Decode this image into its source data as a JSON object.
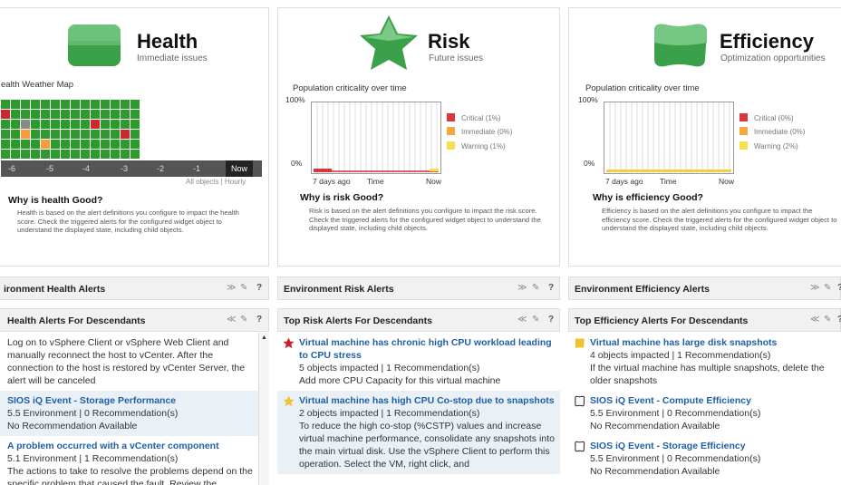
{
  "health": {
    "title": "Health",
    "subtitle": "Immediate issues",
    "map_title": "ealth Weather Map",
    "time_labels": [
      "-6",
      "-5",
      "-4",
      "-3",
      "-2",
      "-1"
    ],
    "now_label": "Now",
    "footer": "All objects | Hourly",
    "why_title": "Why is health Good?",
    "why_text": "Health is based on the alert definitions you configure to impact the health score. Check the triggered alerts for the configured widget object to understand the displayed state, including child objects.",
    "cells": [
      "g",
      "g",
      "g",
      "g",
      "g",
      "g",
      "g",
      "g",
      "g",
      "g",
      "g",
      "g",
      "g",
      "g",
      "r",
      "g",
      "g",
      "g",
      "g",
      "g",
      "g",
      "g",
      "g",
      "g",
      "g",
      "g",
      "g",
      "g",
      "g",
      "g",
      "gr",
      "g",
      "g",
      "g",
      "g",
      "g",
      "g",
      "r",
      "g",
      "g",
      "g",
      "g",
      "g",
      "g",
      "o",
      "g",
      "g",
      "g",
      "g",
      "g",
      "g",
      "g",
      "g",
      "g",
      "r",
      "g",
      "g",
      "g",
      "g",
      "g",
      "o",
      "g",
      "g",
      "g",
      "g",
      "g",
      "g",
      "g",
      "g",
      "g",
      "g",
      "g",
      "g",
      "g",
      "g",
      "g",
      "g",
      "g",
      "g",
      "g",
      "g",
      "g",
      "g",
      "g"
    ],
    "colors": {
      "g": "#2c9a2c",
      "r": "#d0262f",
      "o": "#f59b38",
      "gr": "#8a8a8a"
    }
  },
  "risk": {
    "title": "Risk",
    "subtitle": "Future issues",
    "chart_title": "Population criticality over time",
    "y_top": "100%",
    "y_bottom": "0%",
    "x_start": "7 days ago",
    "x_mid": "Time",
    "x_end": "Now",
    "legend": [
      {
        "label": "Critical (1%)",
        "color": "#d9363e"
      },
      {
        "label": "Immediate (0%)",
        "color": "#f5a742"
      },
      {
        "label": "Warning (1%)",
        "color": "#f4e04d"
      }
    ],
    "why_title": "Why is risk Good?",
    "why_text": "Risk is based on the alert definitions you configure to impact the risk score. Check the triggered alerts for the configured widget object to understand the displayed state, including child objects."
  },
  "efficiency": {
    "title": "Efficiency",
    "subtitle": "Optimization opportunities",
    "chart_title": "Population criticality over time",
    "y_top": "100%",
    "y_bottom": "0%",
    "x_start": "7 days ago",
    "x_mid": "Time",
    "x_end": "Now",
    "legend": [
      {
        "label": "Critical (0%)",
        "color": "#d9363e"
      },
      {
        "label": "Immediate (0%)",
        "color": "#f5a742"
      },
      {
        "label": "Warning (2%)",
        "color": "#f4e04d"
      }
    ],
    "why_title": "Why is efficiency Good?",
    "why_text": "Efficiency is based on the alert definitions you configure to impact the efficiency score. Check the triggered alerts for the configured widget object to understand the displayed state, including child objects."
  },
  "bars": {
    "env_health": "ironment Health Alerts",
    "env_risk": "Environment Risk Alerts",
    "env_eff": "Environment Efficiency Alerts",
    "top_health": "Health Alerts For Descendants",
    "top_risk": "Top Risk Alerts For Descendants",
    "top_eff": "Top Efficiency Alerts For Descendants",
    "icon_collapse": "≫",
    "icon_expand": "≪",
    "icon_edit": "✎",
    "icon_help": "?"
  },
  "health_alerts": [
    {
      "title": "",
      "lines": [
        "Log on to vSphere Client or vSphere Web Client and manually reconnect the host to vCenter. After the connection to the host is restored by vCenter Server, the alert will be canceled"
      ]
    },
    {
      "title": "SIOS iQ Event - Storage Performance",
      "lines": [
        "5.5 Environment | 0 Recommendation(s)",
        "No Recommendation Available"
      ]
    },
    {
      "title": "A problem occurred with a vCenter component",
      "lines": [
        "5.1 Environment | 1 Recommendation(s)",
        "The actions to take to resolve the problems depend on the specific problem that caused the fault. Review the"
      ]
    }
  ],
  "risk_alerts": [
    {
      "title": "Virtual machine has chronic high CPU workload leading to CPU stress",
      "lines": [
        "5 objects impacted | 1 Recommendation(s)",
        "Add more CPU Capacity for this virtual machine"
      ],
      "icon": "star-red"
    },
    {
      "title": "Virtual machine has high CPU Co-stop due to snapshots",
      "lines": [
        "2 objects impacted | 1 Recommendation(s)",
        "To reduce the high co-stop (%CSTP) values and increase virtual machine performance, consolidate any snapshots into the main virtual disk. Use the vSphere Client to perform this operation. Select the VM, right click, and"
      ],
      "icon": "star-yellow"
    }
  ],
  "eff_alerts": [
    {
      "title": "Virtual machine has large disk snapshots",
      "lines": [
        "4 objects impacted | 1 Recommendation(s)",
        "If the virtual machine has multiple snapshots, delete the older snapshots"
      ],
      "icon": "blob-yellow"
    },
    {
      "title": "SIOS iQ Event - Compute Efficiency",
      "lines": [
        "5.5 Environment | 0 Recommendation(s)",
        "No Recommendation Available"
      ],
      "icon": "blob-outline"
    },
    {
      "title": "SIOS iQ Event - Storage Efficiency",
      "lines": [
        "5.5 Environment | 0 Recommendation(s)",
        "No Recommendation Available"
      ],
      "icon": "blob-outline"
    }
  ]
}
